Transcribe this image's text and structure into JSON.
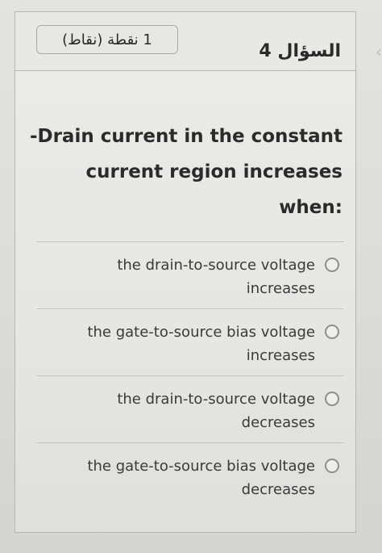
{
  "question": {
    "number_label": "السؤال 4",
    "points_label": "1 نقطة (نقاط)",
    "text_lines": [
      "Drain current in the constant-",
      "current region increases",
      ":when"
    ]
  },
  "options": [
    {
      "lines": [
        "the drain-to-source voltage",
        "increases"
      ],
      "selected": false
    },
    {
      "lines": [
        "the gate-to-source bias voltage",
        "increases"
      ],
      "selected": false
    },
    {
      "lines": [
        "the drain-to-source voltage",
        "decreases"
      ],
      "selected": false
    },
    {
      "lines": [
        "the gate-to-source bias voltage",
        "decreases"
      ],
      "selected": false
    }
  ],
  "nav": {
    "edge_icon": "chevron-left-icon",
    "edge_glyph": "‹"
  }
}
